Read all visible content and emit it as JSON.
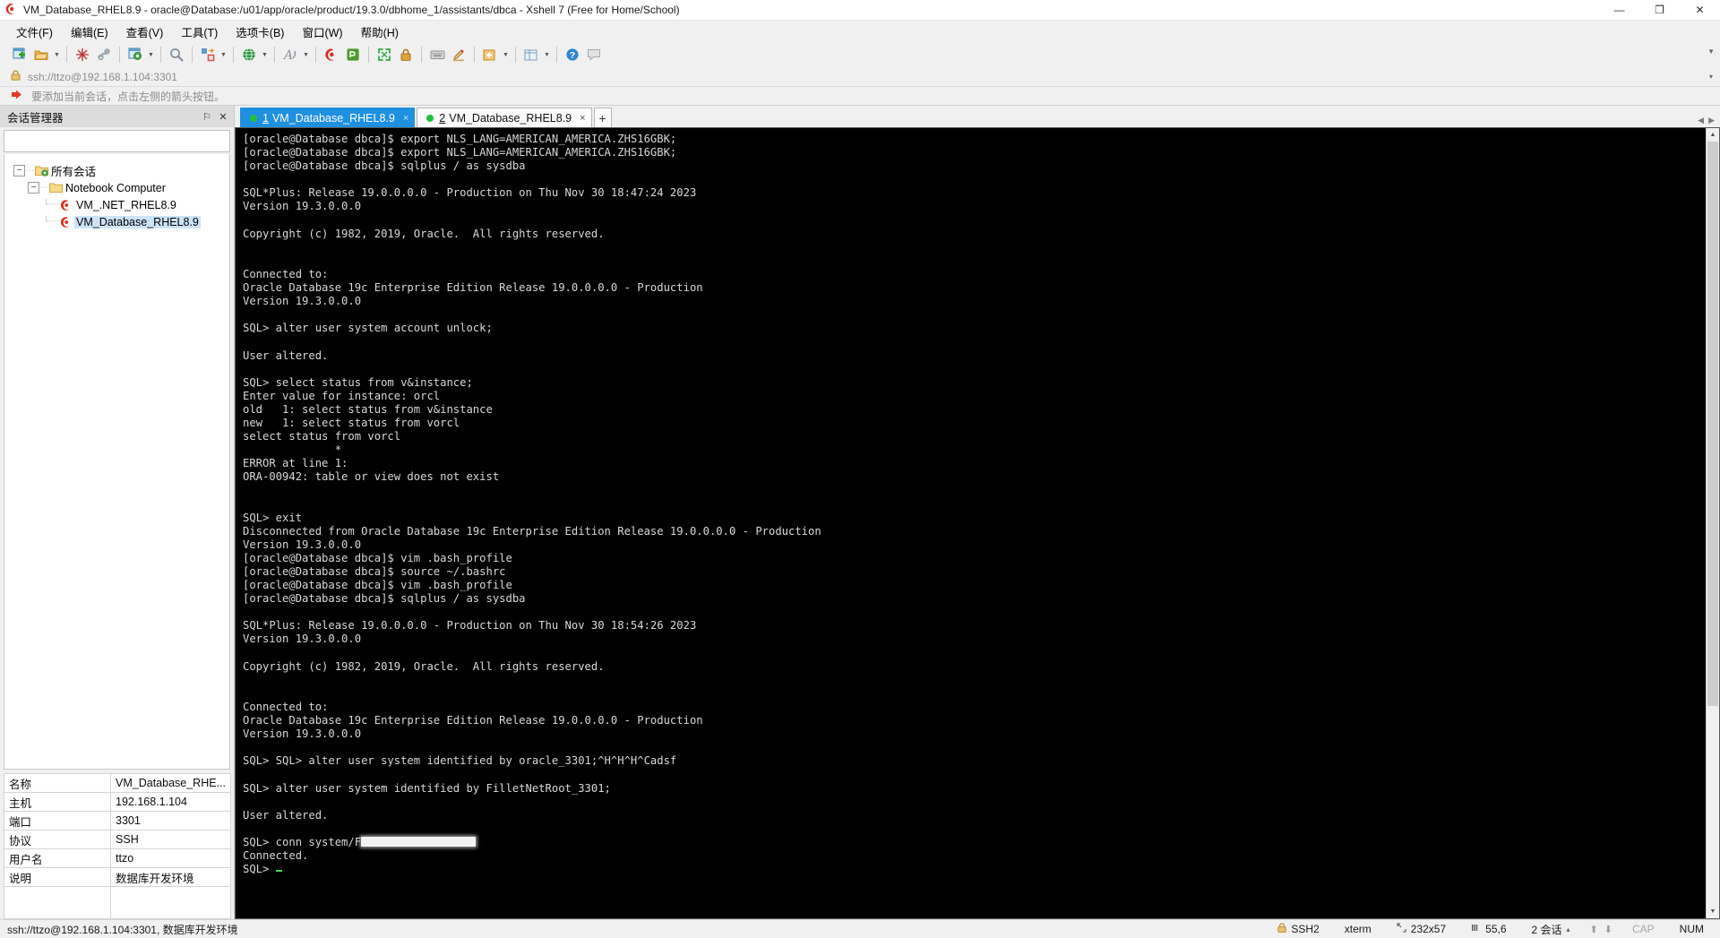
{
  "window": {
    "title": "VM_Database_RHEL8.9 - oracle@Database:/u01/app/oracle/product/19.3.0/dbhome_1/assistants/dbca - Xshell 7 (Free for Home/School)",
    "app_icon": "xshell-icon",
    "minimize": "—",
    "maximize": "❐",
    "close": "✕"
  },
  "menu": {
    "items": [
      {
        "label": "文件(F)",
        "name": "menu-file"
      },
      {
        "label": "编辑(E)",
        "name": "menu-edit"
      },
      {
        "label": "查看(V)",
        "name": "menu-view"
      },
      {
        "label": "工具(T)",
        "name": "menu-tools"
      },
      {
        "label": "选项卡(B)",
        "name": "menu-tabs"
      },
      {
        "label": "窗口(W)",
        "name": "menu-window"
      },
      {
        "label": "帮助(H)",
        "name": "menu-help"
      }
    ]
  },
  "toolbar": {
    "expand_caret": "▾",
    "buttons": [
      "new-session-icon",
      "open-folder-icon",
      "reconnect-icon",
      "disconnect-icon",
      "session-properties-icon",
      "find-icon",
      "transfer-icon",
      "globe-icon",
      "font-icon",
      "xshell-icon",
      "xftp-icon",
      "fullscreen-icon",
      "lock-icon",
      "keyboard-icon",
      "compose-icon",
      "new-tab-icon",
      "layout-icon",
      "help-icon",
      "chat-icon"
    ]
  },
  "address_bar": {
    "lock_icon": "lock-icon",
    "url": "ssh://ttzo@192.168.1.104:3301",
    "caret": "▾"
  },
  "hint_bar": {
    "arrow_icon": "red-arrow-icon",
    "text": "要添加当前会话，点击左侧的箭头按钮。"
  },
  "sidebar": {
    "header": {
      "title": "会话管理器",
      "pin_label": "⚐",
      "close_label": "✕"
    },
    "search": {
      "value": "",
      "placeholder": ""
    },
    "tree": [
      {
        "label": "所有会话",
        "icon": "folder-sessions-icon",
        "level": 0,
        "expanded": true,
        "selected": false
      },
      {
        "label": "Notebook Computer",
        "icon": "folder-icon",
        "level": 1,
        "expanded": true,
        "selected": false
      },
      {
        "label": "VM_.NET_RHEL8.9",
        "icon": "session-icon",
        "level": 2,
        "expanded": false,
        "selected": false
      },
      {
        "label": "VM_Database_RHEL8.9",
        "icon": "session-icon",
        "level": 2,
        "expanded": false,
        "selected": true
      }
    ],
    "properties": [
      {
        "key": "名称",
        "value": "VM_Database_RHE..."
      },
      {
        "key": "主机",
        "value": "192.168.1.104"
      },
      {
        "key": "端口",
        "value": "3301"
      },
      {
        "key": "协议",
        "value": "SSH"
      },
      {
        "key": "用户名",
        "value": "ttzo"
      },
      {
        "key": "说明",
        "value": "数据库开发环境"
      }
    ]
  },
  "tabs": {
    "items": [
      {
        "num": "1",
        "label": "VM_Database_RHEL8.9",
        "active": true,
        "status": "connected",
        "close": "×"
      },
      {
        "num": "2",
        "label": "VM_Database_RHEL8.9",
        "active": false,
        "status": "connected",
        "close": "×"
      }
    ],
    "add_label": "+",
    "nav_left": "◀",
    "nav_right": "▶"
  },
  "terminal": {
    "lines": [
      "[oracle@Database dbca]$ export NLS_LANG=AMERICAN_AMERICA.ZHS16GBK;",
      "[oracle@Database dbca]$ export NLS_LANG=AMERICAN_AMERICA.ZHS16GBK;",
      "[oracle@Database dbca]$ sqlplus / as sysdba",
      "",
      "SQL*Plus: Release 19.0.0.0.0 - Production on Thu Nov 30 18:47:24 2023",
      "Version 19.3.0.0.0",
      "",
      "Copyright (c) 1982, 2019, Oracle.  All rights reserved.",
      "",
      "",
      "Connected to:",
      "Oracle Database 19c Enterprise Edition Release 19.0.0.0.0 - Production",
      "Version 19.3.0.0.0",
      "",
      "SQL> alter user system account unlock;",
      "",
      "User altered.",
      "",
      "SQL> select status from v&instance;",
      "Enter value for instance: orcl",
      "old   1: select status from v&instance",
      "new   1: select status from vorcl",
      "select status from vorcl",
      "              *",
      "ERROR at line 1:",
      "ORA-00942: table or view does not exist",
      "",
      "",
      "SQL> exit",
      "Disconnected from Oracle Database 19c Enterprise Edition Release 19.0.0.0.0 - Production",
      "Version 19.3.0.0.0",
      "[oracle@Database dbca]$ vim .bash_profile",
      "[oracle@Database dbca]$ source ~/.bashrc",
      "[oracle@Database dbca]$ vim .bash_profile",
      "[oracle@Database dbca]$ sqlplus / as sysdba",
      "",
      "SQL*Plus: Release 19.0.0.0.0 - Production on Thu Nov 30 18:54:26 2023",
      "Version 19.3.0.0.0",
      "",
      "Copyright (c) 1982, 2019, Oracle.  All rights reserved.",
      "",
      "",
      "Connected to:",
      "Oracle Database 19c Enterprise Edition Release 19.0.0.0.0 - Production",
      "Version 19.3.0.0.0",
      "",
      "SQL> SQL> alter user system identified by oracle_3301;^H^H^H^Cadsf",
      "",
      "SQL> alter user system identified by FilletNetRoot_3301;",
      "",
      "User altered.",
      ""
    ],
    "redacted_line_prefix": "SQL> conn system/F",
    "tail_lines": [
      "Connected.",
      "SQL> "
    ]
  },
  "statusbar": {
    "left": "ssh://ttzo@192.168.1.104:3301, 数据库开发环境",
    "ssh_icon": "lock-icon",
    "ssh": "SSH2",
    "term_type": "xterm",
    "size_icon": "resize-icon",
    "size": "232x57",
    "cursor_icon": "cursor-icon",
    "cursor": "55,6",
    "sessions": "2 会话",
    "sessions_caret": "▴",
    "up_arrow": "⬆",
    "down_arrow": "⬇",
    "cap": "CAP",
    "num": "NUM"
  },
  "colors": {
    "accent": "#1f8fe0",
    "terminal_bg": "#000000",
    "terminal_fg": "#d8d8d8",
    "status_green": "#22c03a",
    "chrome": "#f0f0f0"
  }
}
